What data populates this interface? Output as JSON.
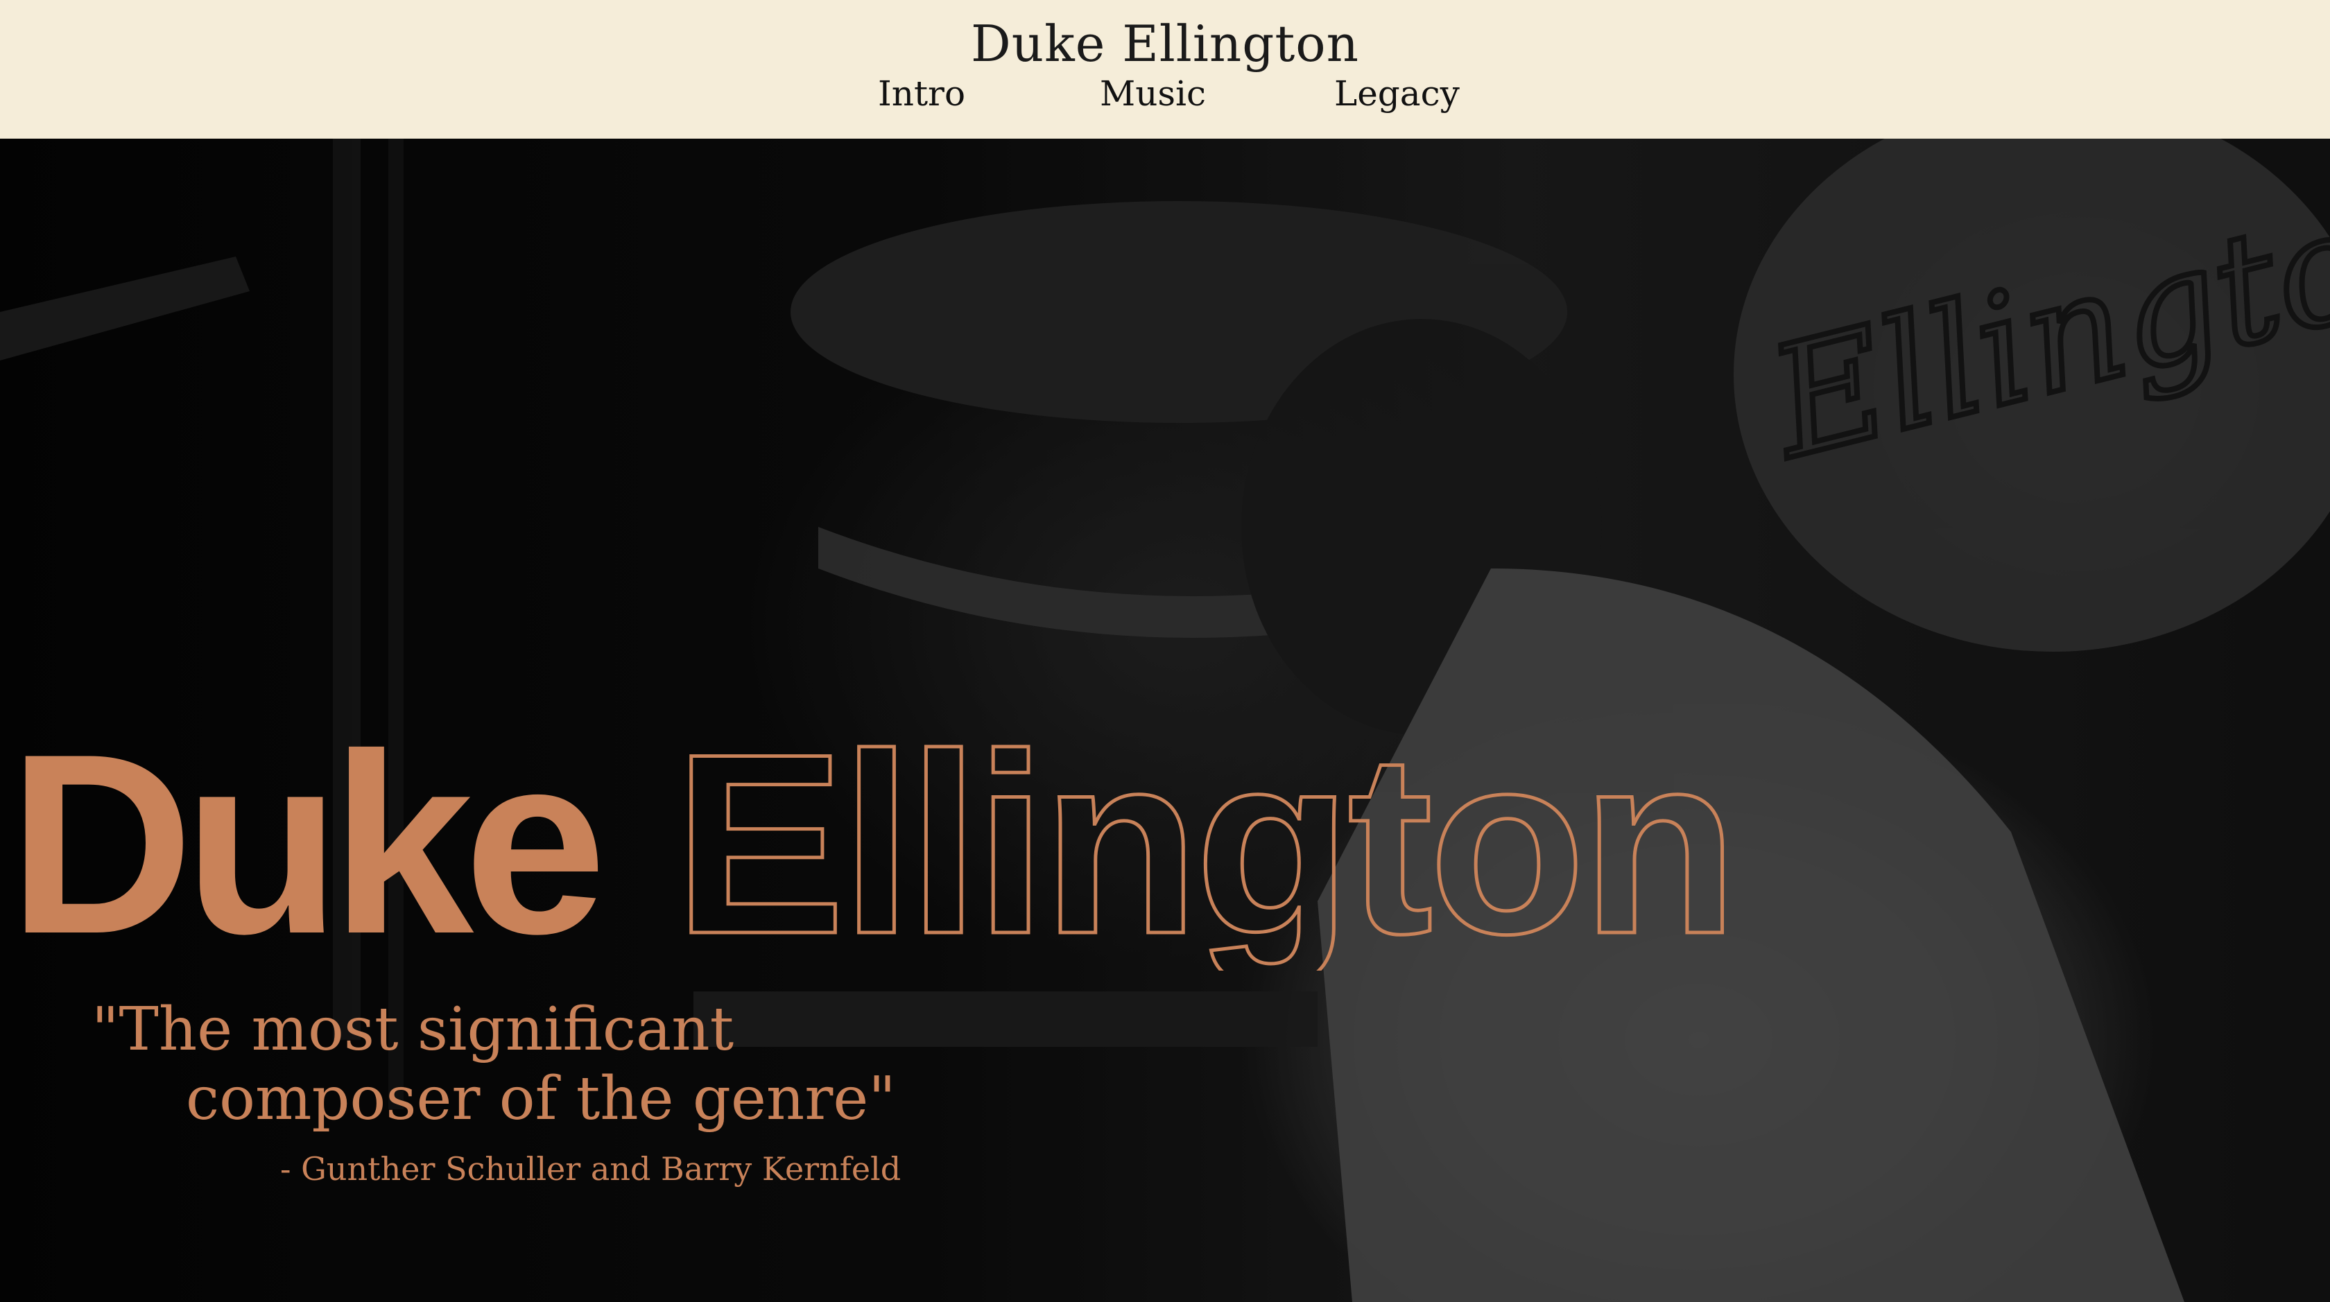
{
  "site": {
    "title": "Duke Ellington"
  },
  "nav": {
    "items": [
      "Intro",
      "Music",
      "Legacy"
    ]
  },
  "hero": {
    "first_name": "Duke",
    "last_name": "Ellington",
    "sign_text": "Ellington",
    "quote_line1": "\"The most significant",
    "quote_line2": "composer of the genre\"",
    "attribution": "- Gunther Schuller and Barry Kernfeld"
  },
  "colors": {
    "header_bg": "#f5edd9",
    "accent": "#c98259",
    "hero_bg": "#000000"
  }
}
